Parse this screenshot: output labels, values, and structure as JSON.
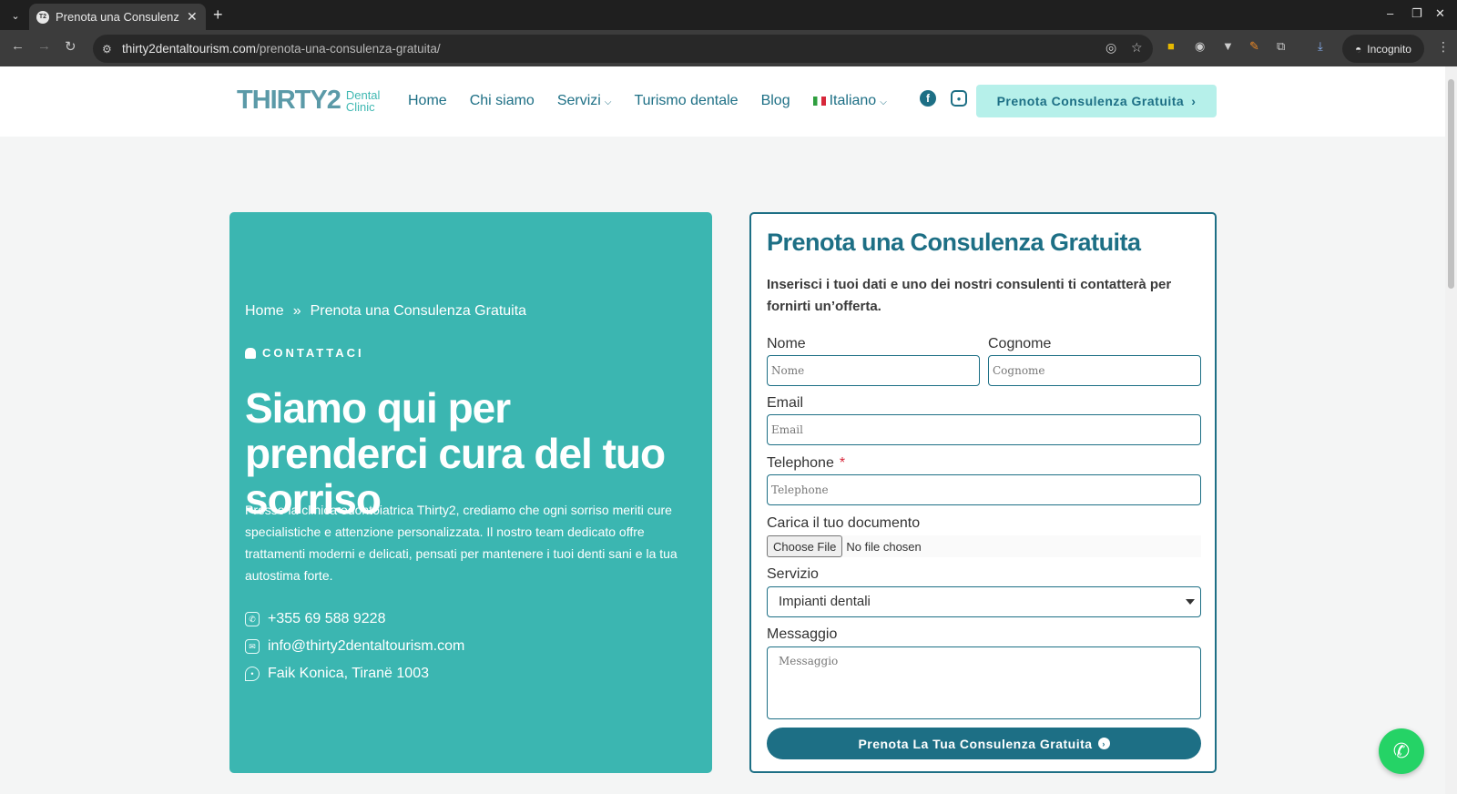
{
  "browser": {
    "tab_title": "Prenota una Consulenza Gratuita",
    "tab_favicon": "T2",
    "url_domain": "thirty2dentaltourism.com",
    "url_path": "/prenota-una-consulenza-gratuita/",
    "incognito_label": "Incognito"
  },
  "header": {
    "logo_main": "THIRTY2",
    "logo_sub1": "Dental",
    "logo_sub2": "Clinic",
    "nav": {
      "home": "Home",
      "about": "Chi siamo",
      "services": "Servizi",
      "tourism": "Turismo dentale",
      "blog": "Blog",
      "language": "Italiano"
    },
    "cta": "Prenota Consulenza Gratuita"
  },
  "hero": {
    "breadcrumb_home": "Home",
    "breadcrumb_sep": "»",
    "breadcrumb_current": "Prenota una Consulenza Gratuita",
    "kicker": "CONTATTACI",
    "title": "Siamo qui per prenderci cura del tuo sorriso",
    "description": "Presso la clinica odontoiatrica Thirty2, crediamo che ogni sorriso meriti cure specialistiche e attenzione personalizzata. Il nostro team dedicato offre trattamenti moderni e delicati, pensati per mantenere i tuoi denti sani e la tua autostima forte.",
    "phone": "+355 69 588 9228",
    "email": "info@thirty2dentaltourism.com",
    "address": "Faik Konica, Tiranë 1003"
  },
  "form": {
    "title": "Prenota una Consulenza Gratuita",
    "intro": "Inserisci i tuoi dati e uno dei nostri consulenti ti contatterà per fornirti un’offerta.",
    "first_name_label": "Nome",
    "first_name_placeholder": "Nome",
    "last_name_label": "Cognome",
    "last_name_placeholder": "Cognome",
    "email_label": "Email",
    "email_placeholder": "Email",
    "phone_label": "Telephone",
    "phone_required": "*",
    "phone_placeholder": "Telephone",
    "upload_label": "Carica il tuo documento",
    "choose_file": "Choose File",
    "no_file": "No file chosen",
    "service_label": "Servizio",
    "service_value": "Impianti dentali",
    "message_label": "Messaggio",
    "message_placeholder": "Messaggio",
    "submit": "Prenota La Tua Consulenza Gratuita"
  },
  "colors": {
    "brand_dark": "#1d6f85",
    "brand_teal": "#3bb6b1",
    "cta_light": "#b6f0ea",
    "whatsapp": "#25d366"
  }
}
